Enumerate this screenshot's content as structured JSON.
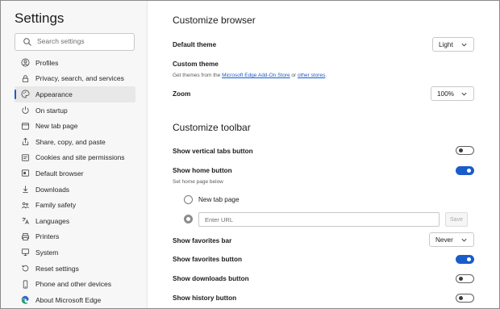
{
  "sidebar": {
    "title": "Settings",
    "search_placeholder": "Search settings",
    "items": [
      {
        "label": "Profiles"
      },
      {
        "label": "Privacy, search, and services"
      },
      {
        "label": "Appearance"
      },
      {
        "label": "On startup"
      },
      {
        "label": "New tab page"
      },
      {
        "label": "Share, copy, and paste"
      },
      {
        "label": "Cookies and site permissions"
      },
      {
        "label": "Default browser"
      },
      {
        "label": "Downloads"
      },
      {
        "label": "Family safety"
      },
      {
        "label": "Languages"
      },
      {
        "label": "Printers"
      },
      {
        "label": "System"
      },
      {
        "label": "Reset settings"
      },
      {
        "label": "Phone and other devices"
      },
      {
        "label": "About Microsoft Edge"
      }
    ]
  },
  "browser": {
    "heading": "Customize browser",
    "default_theme_label": "Default theme",
    "default_theme_value": "Light",
    "custom_theme_label": "Custom theme",
    "custom_theme_prefix": "Get themes from the ",
    "custom_theme_link1": "Microsoft Edge Add-On Store",
    "custom_theme_mid": " or ",
    "custom_theme_link2": "other stores",
    "custom_theme_suffix": ".",
    "zoom_label": "Zoom",
    "zoom_value": "100%"
  },
  "toolbar": {
    "heading": "Customize toolbar",
    "vertical_tabs_label": "Show vertical tabs button",
    "vertical_tabs_on": false,
    "home_button_label": "Show home button",
    "home_button_on": true,
    "home_sub": "Set home page below",
    "new_tab_option": "New tab page",
    "url_placeholder": "Enter URL",
    "save_label": "Save",
    "favorites_bar_label": "Show favorites bar",
    "favorites_bar_value": "Never",
    "favorites_button_label": "Show favorites button",
    "favorites_button_on": true,
    "downloads_button_label": "Show downloads button",
    "downloads_button_on": false,
    "history_button_label": "Show history button",
    "history_button_on": false
  },
  "colors": {
    "accent": "#1a5cc9",
    "sidebar_bg": "#f7f7f7",
    "active_item_bg": "#e8e8e8"
  }
}
